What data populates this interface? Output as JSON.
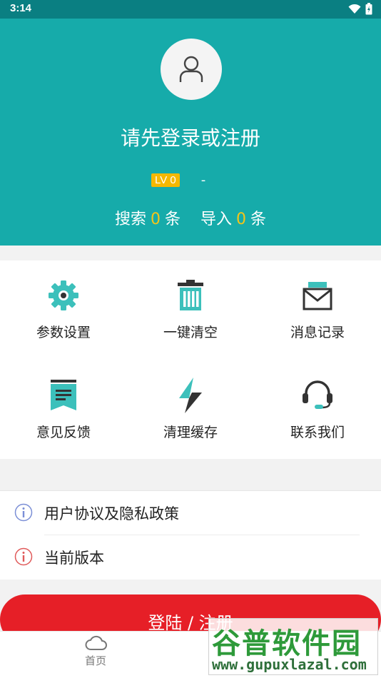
{
  "status_bar": {
    "time": "3:14"
  },
  "profile": {
    "login_prompt": "请先登录或注册",
    "level_badge": "LV 0",
    "level_extra": "-",
    "stats": [
      {
        "label": "搜索",
        "value": "0",
        "unit": "条"
      },
      {
        "label": "导入",
        "value": "0",
        "unit": "条"
      }
    ]
  },
  "grid": {
    "items": [
      {
        "label": "参数设置",
        "icon": "gear-icon"
      },
      {
        "label": "一键清空",
        "icon": "trash-icon"
      },
      {
        "label": "消息记录",
        "icon": "mail-icon"
      },
      {
        "label": "意见反馈",
        "icon": "feedback-icon"
      },
      {
        "label": "清理缓存",
        "icon": "lightning-icon"
      },
      {
        "label": "联系我们",
        "icon": "headset-icon"
      }
    ]
  },
  "list": {
    "items": [
      {
        "label": "用户协议及隐私政策",
        "icon": "info-icon",
        "icon_color": "#7b8fd6"
      },
      {
        "label": "当前版本",
        "icon": "info-icon",
        "icon_color": "#e05a5a"
      }
    ]
  },
  "login_button": "登陆 / 注册",
  "bottom_nav": {
    "home_label": "首页",
    "home_icon": "cloud-icon"
  },
  "watermark": {
    "title": "谷普软件园",
    "url": "www.gupuxlazal.com"
  },
  "colors": {
    "header": "#16abaa",
    "accent_teal": "#3cc0bb",
    "badge": "#f5b800",
    "login_button": "#e61f27"
  }
}
